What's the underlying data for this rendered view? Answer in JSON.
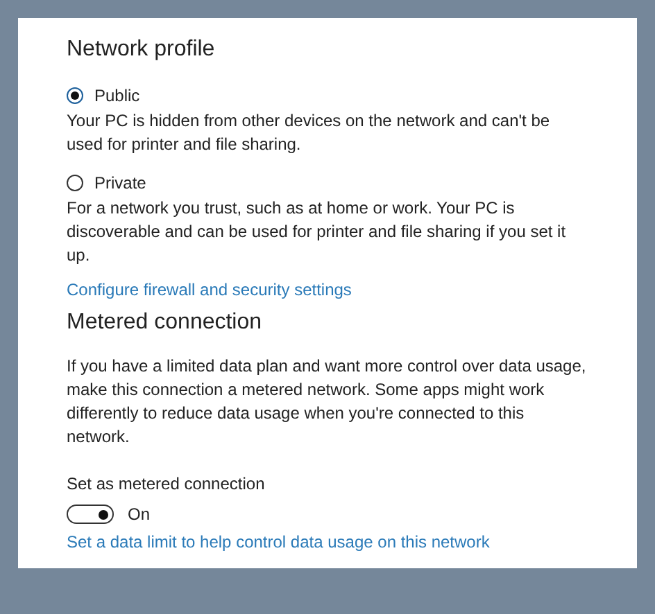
{
  "network_profile": {
    "title": "Network profile",
    "options": [
      {
        "label": "Public",
        "selected": true,
        "description": "Your PC is hidden from other devices on the network and can't be used for printer and file sharing."
      },
      {
        "label": "Private",
        "selected": false,
        "description": "For a network you trust, such as at home or work. Your PC is discoverable and can be used for printer and file sharing if you set it up."
      }
    ],
    "link": "Configure firewall and security settings"
  },
  "metered_connection": {
    "title": "Metered connection",
    "description": "If you have a limited data plan and want more control over data usage, make this connection a metered network. Some apps might work differently to reduce data usage when you're connected to this network.",
    "toggle": {
      "label": "Set as metered connection",
      "on": true,
      "state_text": "On"
    },
    "link": "Set a data limit to help control data usage on this network"
  }
}
